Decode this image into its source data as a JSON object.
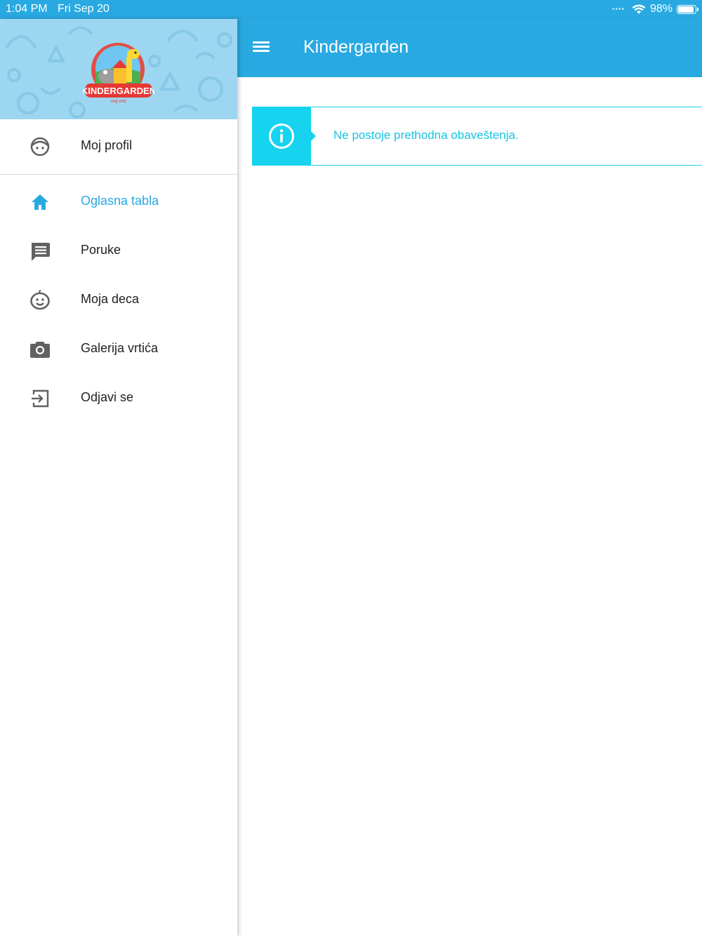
{
  "status_bar": {
    "time": "1:04 PM",
    "date": "Fri Sep 20",
    "battery": "98%",
    "battery_level": 0.98
  },
  "app_bar": {
    "title": "Kindergarden"
  },
  "drawer": {
    "profile_item": {
      "label": "Moj profil",
      "icon": "face-icon"
    },
    "items": [
      {
        "label": "Oglasna tabla",
        "icon": "home-icon",
        "active": true
      },
      {
        "label": "Poruke",
        "icon": "message-icon",
        "active": false
      },
      {
        "label": "Moja deca",
        "icon": "child-face-icon",
        "active": false
      },
      {
        "label": "Galerija vrtića",
        "icon": "camera-icon",
        "active": false
      },
      {
        "label": "Odjavi se",
        "icon": "logout-icon",
        "active": false
      }
    ],
    "logo": {
      "text": "KINDERGARDEN",
      "subtext": "moj vrtić"
    }
  },
  "main": {
    "notice": {
      "text": "Ne postoje prethodna obaveštenja.",
      "icon": "info-icon"
    }
  },
  "colors": {
    "primary": "#29a9e1",
    "notice_accent": "#16d3f0",
    "header_bg": "#9dd6f0",
    "icon_gray": "#616161"
  }
}
